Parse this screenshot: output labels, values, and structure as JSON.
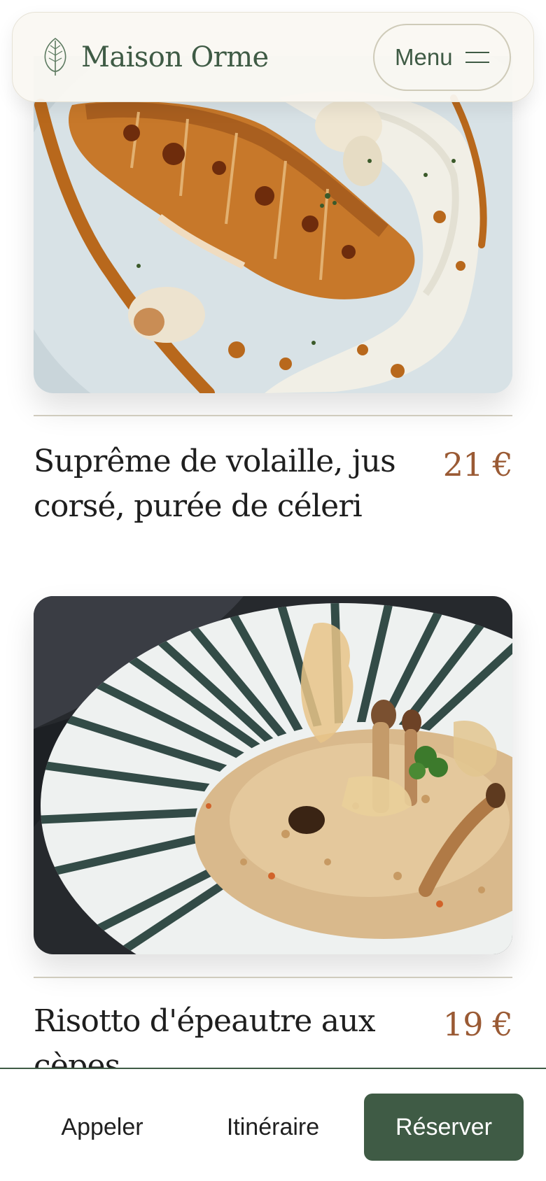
{
  "header": {
    "brand_name": "Maison Orme",
    "menu_label": "Menu"
  },
  "dishes": [
    {
      "name": "Suprême de volaille, jus corsé, purée de céleri",
      "price": "21 €"
    },
    {
      "name": "Risotto d'épeautre aux cèpes",
      "price": "19 €"
    }
  ],
  "actions": {
    "call_label": "Appeler",
    "directions_label": "Itinéraire",
    "reserve_label": "Réserver"
  },
  "colors": {
    "brand_green": "#3f5b45",
    "price_brown": "#9a5a34",
    "header_bg": "#faf8f2"
  }
}
